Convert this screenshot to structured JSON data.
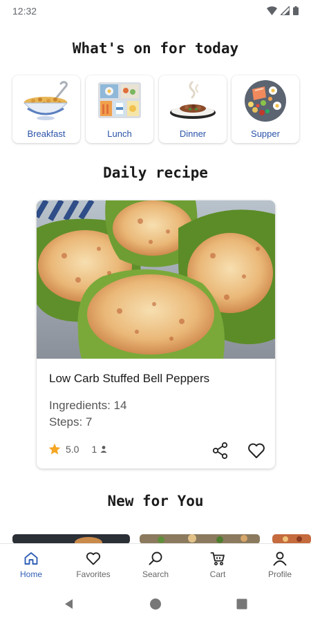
{
  "status_bar": {
    "time": "12:32"
  },
  "header": {
    "title": "What's on for today"
  },
  "categories": [
    {
      "label": "Breakfast",
      "icon": "cereal-bowl-icon"
    },
    {
      "label": "Lunch",
      "icon": "lunch-tray-icon"
    },
    {
      "label": "Dinner",
      "icon": "dinner-plate-icon"
    },
    {
      "label": "Supper",
      "icon": "supper-platter-icon"
    }
  ],
  "daily_recipe": {
    "section_title": "Daily recipe",
    "title": "Low Carb Stuffed Bell Peppers",
    "ingredients": "Ingredients: 14",
    "steps": "Steps: 7",
    "rating": "5.0",
    "users": "1"
  },
  "new_for_you": {
    "section_title": "New for You"
  },
  "bottom_nav": {
    "items": [
      {
        "label": "Home",
        "icon": "home-icon",
        "active": true
      },
      {
        "label": "Favorites",
        "icon": "heart-icon",
        "active": false
      },
      {
        "label": "Search",
        "icon": "search-icon",
        "active": false
      },
      {
        "label": "Cart",
        "icon": "cart-icon",
        "active": false
      },
      {
        "label": "Profile",
        "icon": "person-icon",
        "active": false
      }
    ]
  },
  "colors": {
    "accent": "#2f5fb5",
    "category_label": "#2a53a8",
    "star": "#f5a623"
  }
}
